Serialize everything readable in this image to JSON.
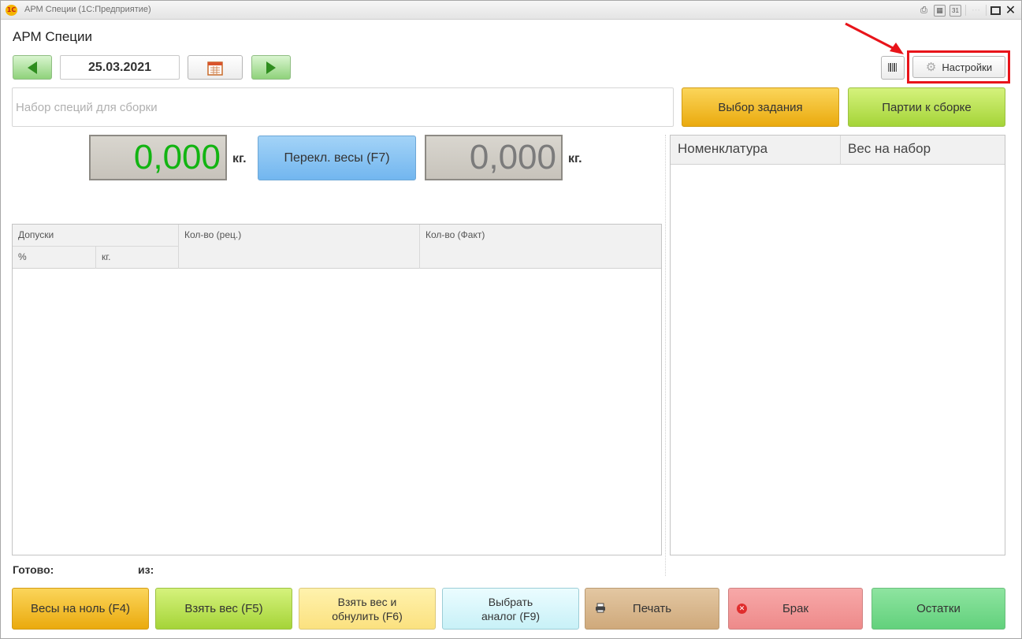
{
  "window": {
    "title": "АРМ Специи  (1С:Предприятие)",
    "logo_text": "1С"
  },
  "titlebar_icons": [
    "print-icon",
    "calculator-icon",
    "calendar-icon",
    "maximize-icon",
    "close-icon"
  ],
  "header": {
    "page_title": "АРМ Специи",
    "date": "25.03.2021",
    "settings_label": "Настройки"
  },
  "search": {
    "placeholder": "Набор специй для сборки",
    "value": ""
  },
  "actions": {
    "select_task": "Выбор задания",
    "batches": "Партии к сборке"
  },
  "scales": {
    "weight_1": "0,000",
    "weight_2": "0,000",
    "unit": "кг.",
    "switch_label": "Перекл. весы (F7)"
  },
  "left_table": {
    "columns": {
      "tolerances": "Допуски",
      "percent": "%",
      "kg": "кг.",
      "qty_recipe": "Кол-во (рец.)",
      "qty_fact": "Кол-во (Факт)"
    },
    "rows": []
  },
  "right_table": {
    "columns": {
      "nomenclature": "Номенклатура",
      "weight": "Вес на набор"
    },
    "rows": []
  },
  "status": {
    "ready_label": "Готово:",
    "of_label": "из:"
  },
  "bottom_buttons": {
    "zero": "Весы на ноль (F4)",
    "take": "Взять вес (F5)",
    "take_zero_1": "Взять вес и",
    "take_zero_2": "обнулить (F6)",
    "analog_1": "Выбрать",
    "analog_2": "аналог (F9)",
    "print": "Печать",
    "defect": "Брак",
    "rest": "Остатки"
  },
  "colors": {
    "highlight": "#e8141a",
    "weight_active": "#12b412",
    "weight_inactive": "#7b7b7b"
  }
}
